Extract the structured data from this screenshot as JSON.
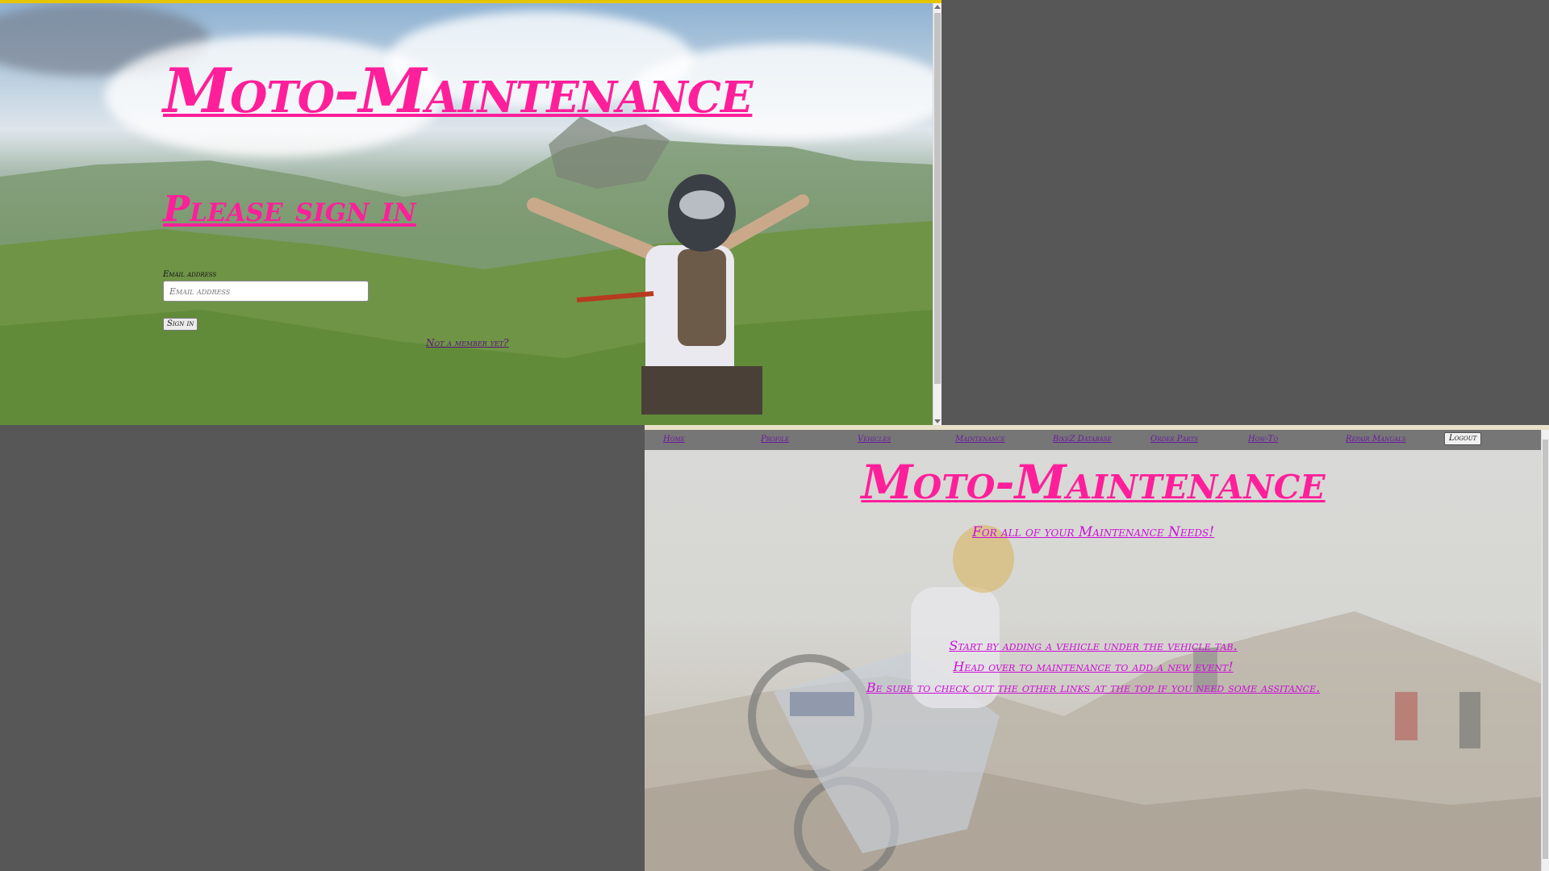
{
  "signin_window": {
    "brand": "Moto-Maintenance",
    "heading": "Please sign in",
    "email_label": "Email address",
    "email_placeholder": "Email address",
    "email_value": "",
    "signin_button": "Sign in",
    "not_member_link": "Not a member yet?"
  },
  "home_window": {
    "nav": {
      "items": [
        "Home",
        "Profile",
        "Vehicles",
        "Maintenance",
        "BikeZ Database",
        "Order Parts",
        "How-To",
        "Repair Manuals"
      ],
      "logout_button": "Logout"
    },
    "brand": "Moto-Maintenance",
    "tagline": "For all of your Maintenance Needs!",
    "messages": [
      "Start by adding a vehicle under the vehicle tab.",
      "Head over to maintenance to add a new event!",
      "Be sure to check out the other links at the top if you need some assitance."
    ]
  },
  "colors": {
    "desktop": "#575757",
    "brand_pink": "#ff1f9a",
    "message_magenta": "#cc10d6",
    "link_purple": "#6a1aa0",
    "top_accent": "#e5c500"
  },
  "icons": [
    "scroll-up-arrow-icon",
    "scroll-down-arrow-icon"
  ]
}
